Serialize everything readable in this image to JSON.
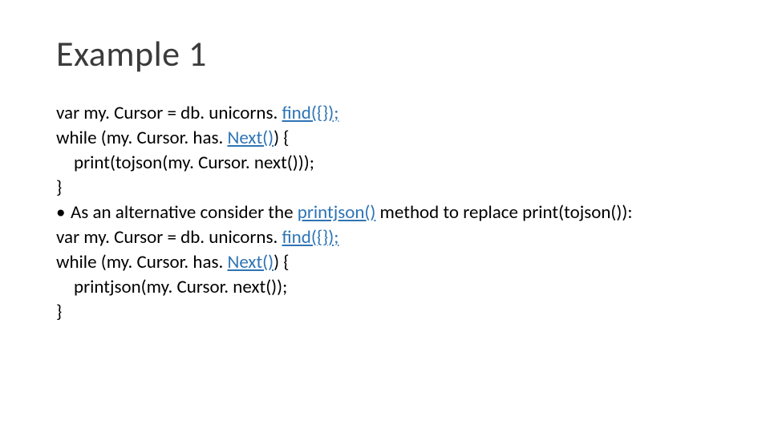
{
  "title": "Example 1",
  "lines": {
    "l1a": "var my. Cursor = db. unicorns. ",
    "l1b": "find({});",
    "l2a": "while (my. Cursor. has. ",
    "l2b": "Next()",
    "l2c": ") {",
    "l3": "print(tojson(my. Cursor. next()));",
    "l4": "}",
    "l5a": "As an alternative consider the ",
    "l5b": "printjson()",
    "l5c": " method to replace print(tojson()):",
    "l6a": "var my. Cursor = db. unicorns. ",
    "l6b": "find({});",
    "l7a": "while (my. Cursor. has. ",
    "l7b": "Next()",
    "l7c": ") {",
    "l8": "printjson(my. Cursor. next());",
    "l9": "}"
  }
}
